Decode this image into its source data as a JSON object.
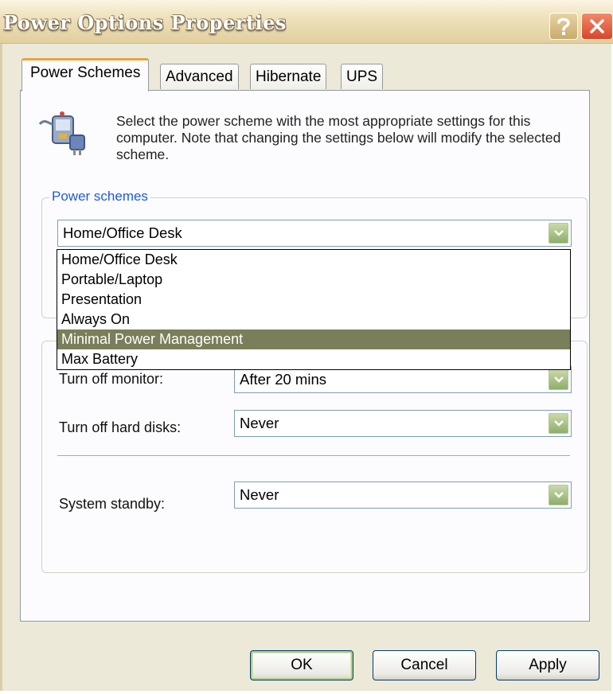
{
  "window": {
    "title": "Power Options Properties"
  },
  "titlebar_buttons": {
    "help_icon": "question-mark-icon",
    "close_icon": "close-x-icon"
  },
  "tabs": [
    {
      "label": "Power Schemes",
      "active": true
    },
    {
      "label": "Advanced",
      "active": false
    },
    {
      "label": "Hibernate",
      "active": false
    },
    {
      "label": "UPS",
      "active": false
    }
  ],
  "description": "Select the power scheme with the most appropriate settings for this computer. Note that changing the settings below will modify the selected scheme.",
  "power_schemes": {
    "legend": "Power schemes",
    "selected": "Home/Office Desk",
    "options": [
      "Home/Office Desk",
      "Portable/Laptop",
      "Presentation",
      "Always On",
      "Minimal Power Management",
      "Max Battery"
    ],
    "highlighted": "Minimal Power Management"
  },
  "settings": {
    "monitor": {
      "label": "Turn off monitor:",
      "value": "After 20 mins"
    },
    "hard_disks": {
      "label": "Turn off hard disks:",
      "value": "Never"
    },
    "standby": {
      "label": "System standby:",
      "value": "Never"
    }
  },
  "buttons": {
    "ok": "OK",
    "cancel": "Cancel",
    "apply": "Apply"
  },
  "colors": {
    "legend": "#1e5bd6",
    "highlight": "#7b7e5a",
    "active_tab_accent": "#e8a33f"
  }
}
